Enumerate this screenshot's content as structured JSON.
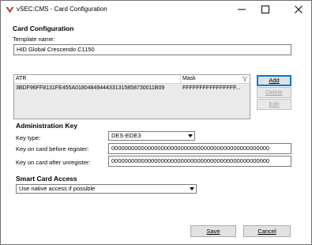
{
  "window": {
    "title": "vSEC:CMS - Card Configuration"
  },
  "card_config": {
    "heading": "Card Configuration",
    "template_label": "Template name:",
    "template_value": "HID Global Crescendo C1150"
  },
  "grid": {
    "columns": {
      "atr": "ATR",
      "mask": "Mask"
    },
    "rows": [
      {
        "atr": "3BDF96FF8131FE455A01804849444331315858730011B09",
        "mask": "FFFFFFFFFFFFFFFF..."
      }
    ]
  },
  "buttons": {
    "add": "Add",
    "delete": "Delete",
    "edit": "Edit",
    "save": "Save",
    "cancel": "Cancel"
  },
  "admin_key": {
    "heading": "Administration Key",
    "key_type_label": "Key type:",
    "key_type_value": "DES-EDE3",
    "before_label": "Key on card before register:",
    "before_value": "000000000000000000000000000000000000000000000000",
    "after_label": "Key on card after unregister:",
    "after_value": "000000000000000000000000000000000000000000000000"
  },
  "smart_card_access": {
    "heading": "Smart Card Access",
    "mode_value": "Use native access if possible"
  }
}
